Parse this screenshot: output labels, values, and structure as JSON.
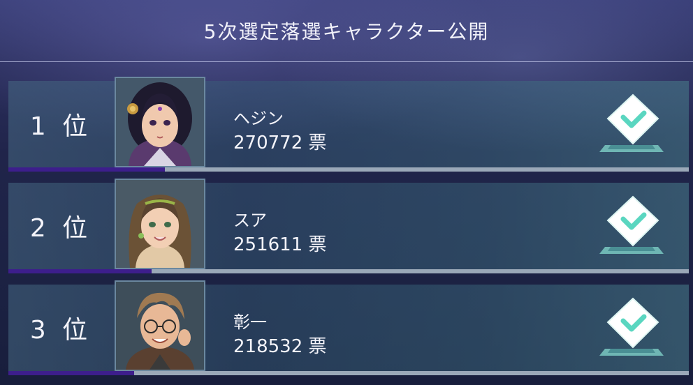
{
  "header": {
    "title": "5次選定落選キャラクター公開"
  },
  "ranking": [
    {
      "rank_label": "1 位",
      "name": "ヘジン",
      "votes": "270772",
      "unit": "票",
      "bar_fraction": 0.23
    },
    {
      "rank_label": "2 位",
      "name": "スア",
      "votes": "251611",
      "unit": "票",
      "bar_fraction": 0.21
    },
    {
      "rank_label": "3 位",
      "name": "彰一",
      "votes": "218532",
      "unit": "票",
      "bar_fraction": 0.185
    }
  ],
  "icons": {
    "vote": "ballot-box-check-icon"
  },
  "colors": {
    "progress": "#3d1e8c",
    "track": "#9aa8b8",
    "accent": "#5ad6c0"
  }
}
